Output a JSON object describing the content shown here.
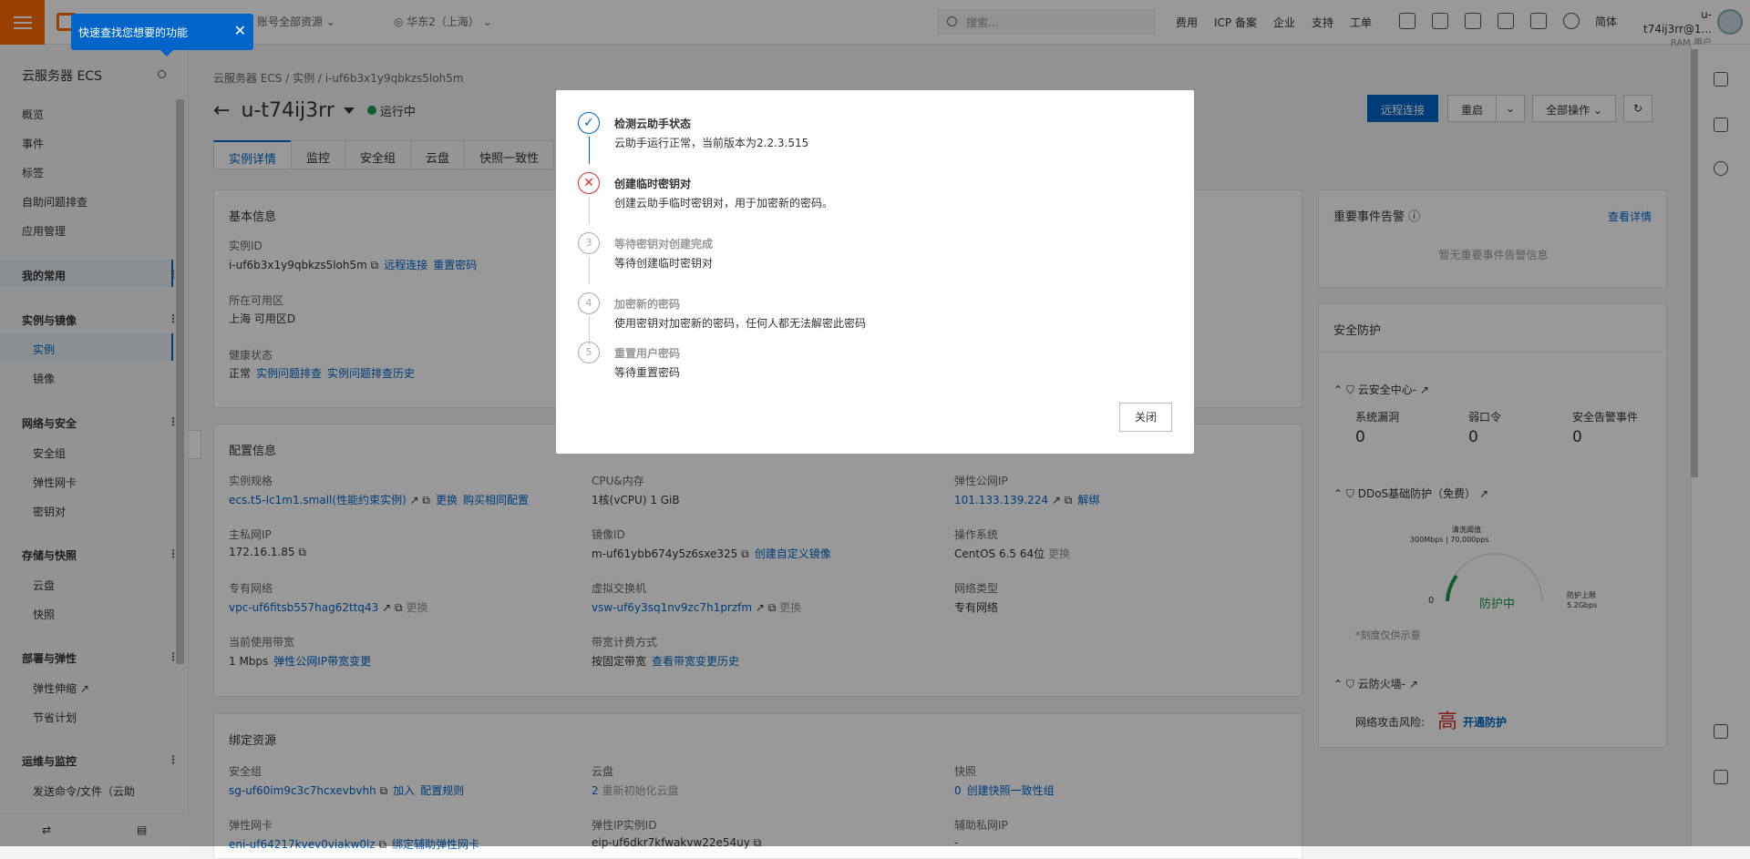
{
  "topbar": {
    "account_scope": "账号全部资源",
    "region": "华东2（上海）",
    "search_placeholder": "搜索...",
    "links": [
      "费用",
      "ICP 备案",
      "企业",
      "支持",
      "工单"
    ],
    "lang": "简体",
    "user_name": "u-t74ij3rr@1...",
    "user_role": "RAM 用户"
  },
  "tooltip": {
    "text": "快速查找您想要的功能"
  },
  "sidebar": {
    "title": "云服务器 ECS",
    "top_items": [
      "概览",
      "事件",
      "标签",
      "自助问题排查",
      "应用管理"
    ],
    "groups": [
      {
        "label": "我的常用",
        "items": []
      },
      {
        "label": "实例与镜像",
        "items": [
          "实例",
          "镜像"
        ]
      },
      {
        "label": "网络与安全",
        "items": [
          "安全组",
          "弹性网卡",
          "密钥对"
        ]
      },
      {
        "label": "存储与快照",
        "items": [
          "云盘",
          "快照"
        ]
      },
      {
        "label": "部署与弹性",
        "items": [
          "弹性伸缩",
          "节省计划"
        ]
      },
      {
        "label": "运维与监控",
        "items": [
          "发送命令/文件（云助"
        ]
      }
    ]
  },
  "breadcrumb": [
    "云服务器 ECS",
    "实例",
    "i-uf6b3x1y9qbkzs5loh5m"
  ],
  "instance": {
    "name": "u-t74ij3rr",
    "status": "运行中"
  },
  "actions": {
    "remote": "远程连接",
    "restart": "重启",
    "all": "全部操作"
  },
  "tabs": [
    "实例详情",
    "监控",
    "安全组",
    "云盘",
    "快照一致性"
  ],
  "basic": {
    "title": "基本信息",
    "id_label": "实例ID",
    "id_value": "i-uf6b3x1y9qbkzs5loh5m",
    "id_link1": "远程连接",
    "id_link2": "重置密码",
    "zone_label": "所在可用区",
    "zone_value": "上海 可用区D",
    "health_label": "健康状态",
    "health_value": "正常",
    "health_link1": "实例问题排查",
    "health_link2": "实例问题排查历史"
  },
  "config": {
    "title": "配置信息",
    "spec_label": "实例规格",
    "spec_value": "ecs.t5-lc1m1.small(性能约束实例)",
    "spec_link1": "更换",
    "spec_link2": "购买相同配置",
    "cpu_label": "CPU&内存",
    "cpu_value": "1核(vCPU)   1 GiB",
    "eip_label": "弹性公网IP",
    "eip_value": "101.133.139.224",
    "eip_link": "解绑",
    "pip_label": "主私网IP",
    "pip_value": "172.16.1.85",
    "img_label": "镜像ID",
    "img_value": "m-uf61ybb674y5z6sxe325",
    "img_link": "创建自定义镜像",
    "os_label": "操作系统",
    "os_value": "CentOS 6.5 64位",
    "os_link": "更换",
    "vpc_label": "专有网络",
    "vpc_value": "vpc-uf6fitsb557hag62ttq43",
    "vpc_link": "更换",
    "vsw_label": "虚拟交换机",
    "vsw_value": "vsw-uf6y3sq1nv9zc7h1przfm",
    "vsw_link": "更换",
    "nettype_label": "网络类型",
    "nettype_value": "专有网络",
    "bw_label": "当前使用带宽",
    "bw_value": "1 Mbps",
    "bw_link": "弹性公网IP带宽变更",
    "billing_label": "带宽计费方式",
    "billing_value": "按固定带宽",
    "billing_link": "查看带宽变更历史"
  },
  "bind": {
    "title": "绑定资源",
    "sg_label": "安全组",
    "sg_value": "sg-uf60im9c3c7hcxevbvhh",
    "sg_link1": "加入",
    "sg_link2": "配置规则",
    "disk_label": "云盘",
    "disk_value": "2",
    "disk_link": "重新初始化云盘",
    "snap_label": "快照",
    "snap_value": "0",
    "snap_link": "创建快照一致性组",
    "eni_label": "弹性网卡",
    "eni_value": "eni-uf64217kvev0viakw0lz",
    "eni_link": "绑定辅助弹性网卡",
    "eipid_label": "弹性IP实例ID",
    "eipid_value": "eip-uf6dkr7kfwakvw22e54uy",
    "sec_ip_label": "辅助私网IP",
    "sec_ip_value": "-"
  },
  "events": {
    "title": "重要事件告警",
    "link": "查看详情",
    "empty": "暂无重要事件告警信息"
  },
  "security": {
    "title": "安全防护",
    "center": "云安全中心-",
    "vuln_label": "系统漏洞",
    "vuln": "0",
    "weak_label": "弱口令",
    "weak": "0",
    "alarm_label": "安全告警事件",
    "alarm": "0",
    "ddos": "DDoS基础防护（免费）",
    "clean_label": "清洗阈值",
    "clean_value": "300Mbps | 70,000pps",
    "gauge_min": "0",
    "gauge_status": "防护中",
    "gauge_max_label": "防护上限",
    "gauge_max": "5.2Gbps",
    "gauge_note": "*刻度仅供示意",
    "firewall": "云防火墙-",
    "risk_label": "网络攻击风险:",
    "risk": "高",
    "risk_link": "开通防护"
  },
  "modal": {
    "steps": [
      {
        "num": "✓",
        "title": "检测云助手状态",
        "desc": "云助手运行正常，当前版本为2.2.3.515",
        "state": "ok"
      },
      {
        "num": "✕",
        "title": "创建临时密钥对",
        "desc": "创建云助手临时密钥对，用于加密新的密码。",
        "state": "err"
      },
      {
        "num": "3",
        "title": "等待密钥对创建完成",
        "desc": "等待创建临时密钥对",
        "state": "wait"
      },
      {
        "num": "4",
        "title": "加密新的密码",
        "desc": "使用密钥对加密新的密码，任何人都无法解密此密码",
        "state": "wait"
      },
      {
        "num": "5",
        "title": "重置用户密码",
        "desc": "等待重置密码",
        "state": "wait"
      }
    ],
    "close": "关闭"
  }
}
